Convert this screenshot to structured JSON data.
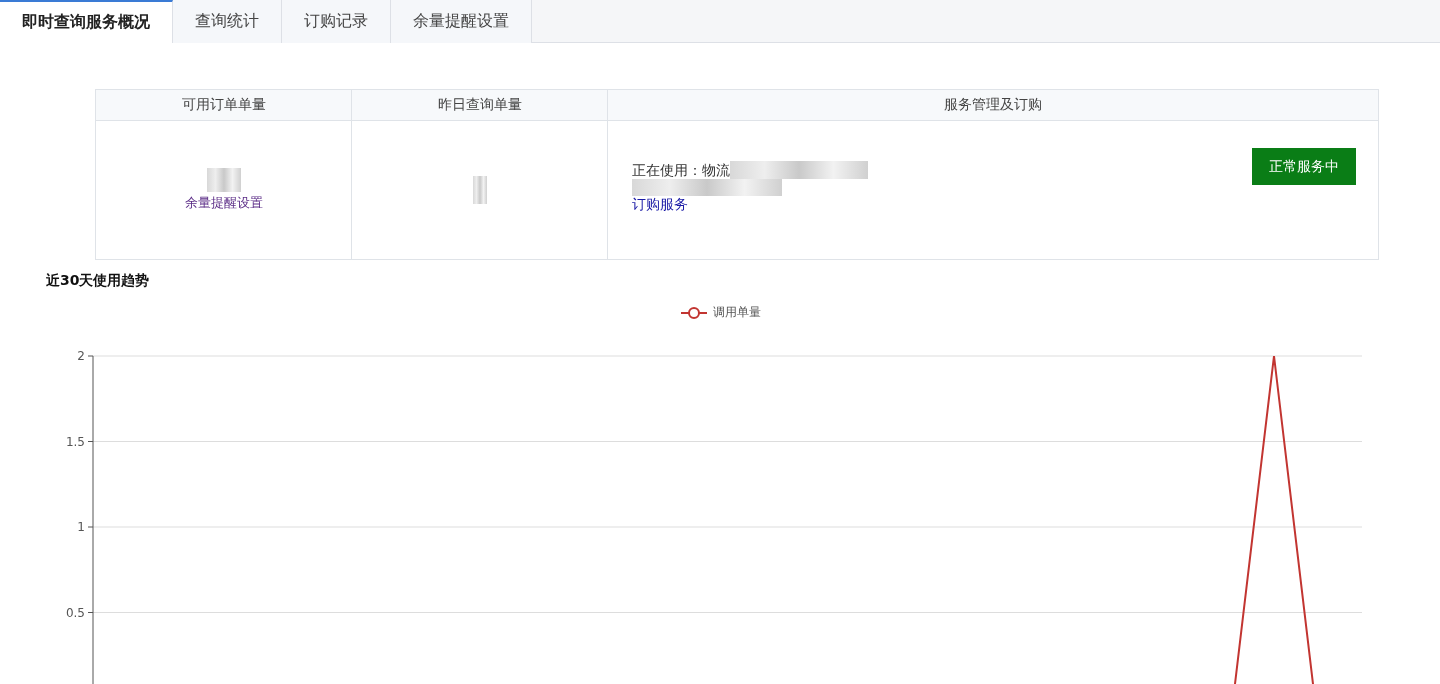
{
  "tabs": [
    {
      "label": "即时查询服务概况",
      "selected": true
    },
    {
      "label": "查询统计",
      "selected": false
    },
    {
      "label": "订购记录",
      "selected": false
    },
    {
      "label": "余量提醒设置",
      "selected": false
    }
  ],
  "summary_table": {
    "columns": [
      "可用订单单量",
      "昨日查询单量",
      "服务管理及订购"
    ],
    "available_cell": {
      "link": "余量提醒设置"
    },
    "service_cell": {
      "in_use": "正在使用：物流",
      "order_link": "订购服务",
      "status_button": "正常服务中"
    }
  },
  "trend": {
    "title": "近30天使用趋势",
    "legend": {
      "label": "调用单量",
      "color": "#c23531"
    },
    "y_axis_labels": [
      "2",
      "1.5",
      "1",
      "0.5"
    ]
  }
}
